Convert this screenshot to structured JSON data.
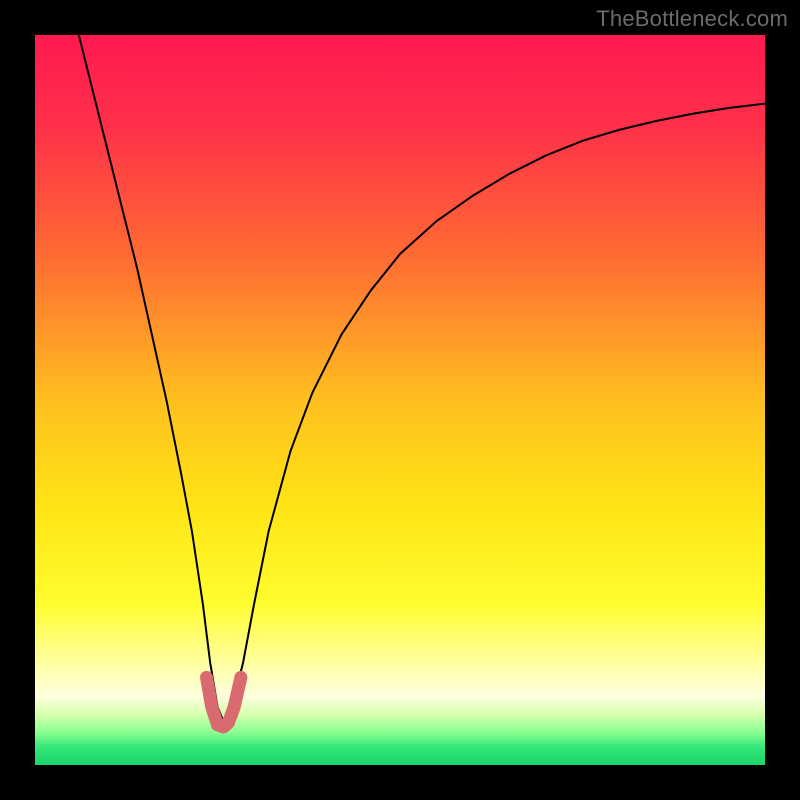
{
  "watermark": "TheBottleneck.com",
  "chart_data": {
    "type": "line",
    "title": "",
    "xlabel": "",
    "ylabel": "",
    "xlim": [
      0,
      100
    ],
    "ylim": [
      0,
      100
    ],
    "gradient_stops": [
      {
        "offset": 0.0,
        "color": "#ff1950"
      },
      {
        "offset": 0.12,
        "color": "#ff2f4a"
      },
      {
        "offset": 0.3,
        "color": "#ff6a33"
      },
      {
        "offset": 0.5,
        "color": "#ffbf1f"
      },
      {
        "offset": 0.65,
        "color": "#ffe515"
      },
      {
        "offset": 0.78,
        "color": "#fffd30"
      },
      {
        "offset": 0.86,
        "color": "#ffffa0"
      },
      {
        "offset": 0.905,
        "color": "#ffffe0"
      },
      {
        "offset": 0.93,
        "color": "#d8ffb0"
      },
      {
        "offset": 0.955,
        "color": "#8bff90"
      },
      {
        "offset": 0.975,
        "color": "#35e879"
      },
      {
        "offset": 1.0,
        "color": "#18d66a"
      }
    ],
    "series": [
      {
        "name": "bottleneck-curve",
        "stroke": "#000000",
        "stroke_width": 2,
        "x": [
          6.0,
          8.0,
          10.0,
          12.0,
          14.0,
          16.0,
          18.0,
          20.0,
          21.5,
          23.0,
          24.0,
          25.0,
          26.0,
          27.0,
          28.5,
          30.0,
          32.0,
          35.0,
          38.0,
          42.0,
          46.0,
          50.0,
          55.0,
          60.0,
          65.0,
          70.0,
          75.0,
          80.0,
          85.0,
          90.0,
          95.0,
          100.0
        ],
        "values": [
          100.0,
          92.0,
          84.0,
          76.0,
          68.0,
          59.0,
          50.0,
          40.0,
          32.0,
          22.0,
          14.0,
          8.0,
          5.5,
          8.0,
          14.0,
          22.0,
          32.0,
          43.0,
          51.0,
          59.0,
          65.0,
          70.0,
          74.5,
          78.0,
          81.0,
          83.5,
          85.5,
          87.0,
          88.2,
          89.2,
          90.0,
          90.6
        ]
      },
      {
        "name": "valley-highlight",
        "stroke": "#d96a6f",
        "stroke_width": 13,
        "linecap": "round",
        "x": [
          23.5,
          24.2,
          25.0,
          25.8,
          26.5,
          27.3,
          28.2
        ],
        "values": [
          12.0,
          8.0,
          5.5,
          5.2,
          5.8,
          8.0,
          12.0
        ]
      }
    ]
  }
}
